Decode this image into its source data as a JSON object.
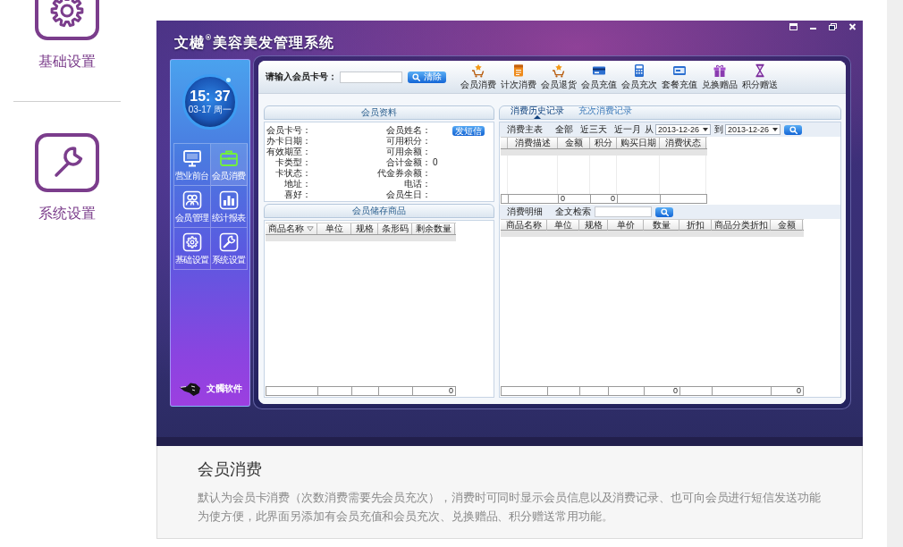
{
  "page_nav": {
    "items": [
      {
        "label": "基础设置"
      },
      {
        "label": "系统设置"
      }
    ]
  },
  "app": {
    "title": "文樾$^{®}$美容美发管理系统",
    "clock": {
      "time": "15: 37",
      "date": "03-17 周一"
    },
    "sidebar": [
      {
        "label": "营业前台",
        "selected": false
      },
      {
        "label": "会员消费",
        "selected": true
      },
      {
        "label": "会员管理",
        "selected": false
      },
      {
        "label": "统计报表",
        "selected": false
      },
      {
        "label": "基础设置",
        "selected": false
      },
      {
        "label": "系统设置",
        "selected": false
      }
    ],
    "brand": "文髑软件",
    "card_search": {
      "label": "请输入会员卡号：",
      "button": "清除"
    },
    "toolbar": [
      "会员消费",
      "计次消费",
      "会员退货",
      "会员充值",
      "会员充次",
      "套餐充值",
      "兑换赠品",
      "积分赠送"
    ],
    "member_info": {
      "title": "会员资料",
      "left_fields": [
        {
          "label": "会员卡号："
        },
        {
          "label": "办卡日期："
        },
        {
          "label": "有效期至："
        },
        {
          "label": "卡类型："
        },
        {
          "label": "卡状态："
        },
        {
          "label": "地址："
        },
        {
          "label": "喜好："
        }
      ],
      "right_fields": [
        {
          "label": "会员姓名："
        },
        {
          "label": "可用积分："
        },
        {
          "label": "可用余额："
        },
        {
          "label": "合计金额：",
          "value": "0"
        },
        {
          "label": "代金券余额："
        },
        {
          "label": "电话："
        },
        {
          "label": "会员生日："
        }
      ],
      "sms_button": "发短信"
    },
    "stored_goods": {
      "title": "会员储存商品",
      "columns": [
        {
          "label": "商品名称",
          "sorted": true
        },
        {
          "label": "单位",
          "sorted": false
        },
        {
          "label": "规格",
          "sorted": false
        },
        {
          "label": "条形码",
          "sorted": false
        },
        {
          "label": "剩余数量",
          "sorted": false,
          "total": "0"
        }
      ]
    },
    "history": {
      "tabs": [
        {
          "label": "消费历史记录",
          "selected": true
        },
        {
          "label": "充次消费记录",
          "selected": false
        }
      ],
      "filter": {
        "label": "消费主表",
        "ranges": [
          "全部",
          "近三天",
          "近一月"
        ],
        "from_label": "从",
        "from_date": "2013-12-26",
        "to_label": "到",
        "to_date": "2013-12-26"
      },
      "columns": [
        {
          "label": "消费描述"
        },
        {
          "label": "金额",
          "total": "0"
        },
        {
          "label": "积分",
          "total": "0"
        },
        {
          "label": "购买日期"
        },
        {
          "label": "消费状态"
        }
      ]
    },
    "details": {
      "label": "消费明细",
      "search_label": "全文检索",
      "columns": [
        {
          "label": "商品名称"
        },
        {
          "label": "单位"
        },
        {
          "label": "规格"
        },
        {
          "label": "单价"
        },
        {
          "label": "数量",
          "total": "0"
        },
        {
          "label": "折扣"
        },
        {
          "label": "商品分类折扣"
        },
        {
          "label": "金额",
          "total": "0"
        }
      ]
    }
  },
  "caption": {
    "title": "会员消费",
    "text": "默认为会员卡消费（次数消费需要先会员充次），消费时可同时显示会员信息以及消费记录、也可向会员进行短信发送功能为使方便，此界面另添加有会员充值和会员充次、兑换赠品、积分赠送常用功能。"
  }
}
